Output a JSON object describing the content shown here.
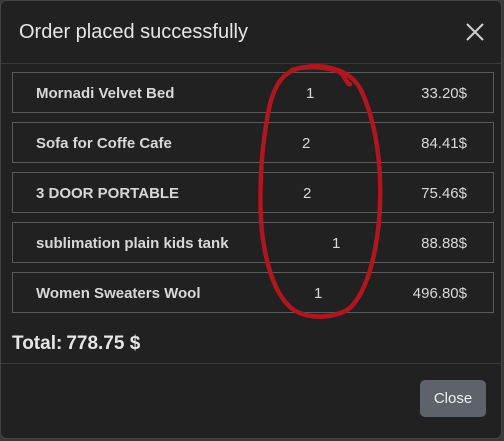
{
  "modal": {
    "title": "Order placed successfully",
    "close_icon": "close-x-icon"
  },
  "items": [
    {
      "name": "Mornadi Velvet Bed",
      "quantity": "1",
      "price": "33.20$"
    },
    {
      "name": "Sofa for Coffe Cafe",
      "quantity": "2",
      "price": "84.41$"
    },
    {
      "name": "3 DOOR PORTABLE",
      "quantity": "2",
      "price": "75.46$"
    },
    {
      "name": "sublimation plain kids tank",
      "quantity": "1",
      "price": "88.88$"
    },
    {
      "name": "Women Sweaters Wool",
      "quantity": "1",
      "price": "496.80$"
    }
  ],
  "total": {
    "label": "Total:",
    "value": "778.75 $"
  },
  "footer": {
    "close_label": "Close"
  },
  "colors": {
    "modal_bg": "#212121",
    "annotation_red": "#b0161e",
    "close_button_bg": "#5c636a"
  }
}
